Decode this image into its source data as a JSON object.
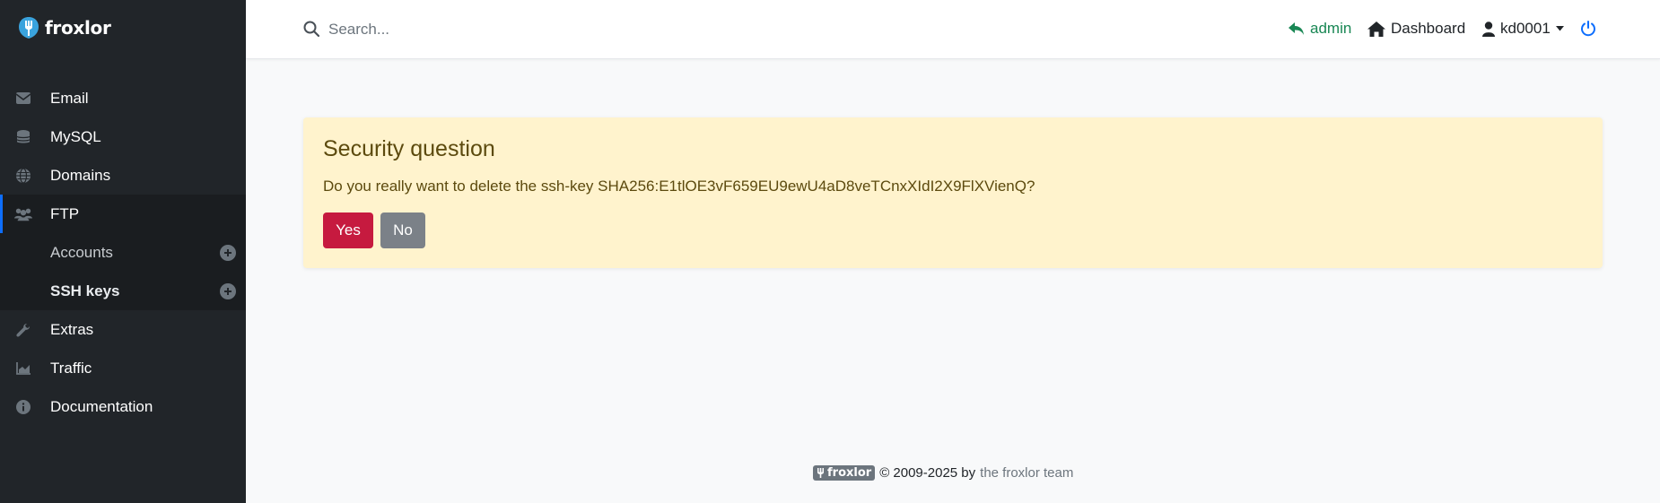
{
  "brand": {
    "name": "froxlor"
  },
  "sidebar": {
    "items": [
      {
        "label": "Email",
        "icon": "envelope-icon"
      },
      {
        "label": "MySQL",
        "icon": "database-icon"
      },
      {
        "label": "Domains",
        "icon": "globe-icon"
      },
      {
        "label": "FTP",
        "icon": "users-icon",
        "active": true
      },
      {
        "label": "Accounts",
        "sub": true,
        "icon": "plus-circle-icon"
      },
      {
        "label": "SSH keys",
        "sub": true,
        "current": true,
        "icon": "plus-circle-icon"
      },
      {
        "label": "Extras",
        "icon": "wrench-icon"
      },
      {
        "label": "Traffic",
        "icon": "chart-area-icon"
      },
      {
        "label": "Documentation",
        "icon": "info-circle-icon"
      }
    ]
  },
  "header": {
    "search_placeholder": "Search...",
    "admin_label": "admin",
    "dashboard_label": "Dashboard",
    "user_label": "kd0001"
  },
  "alert": {
    "title": "Security question",
    "message": "Do you really want to delete the ssh-key SHA256:E1tlOE3vF659EU9ewU4aD8veTCnxXIdI2X9FlXVienQ?",
    "yes_label": "Yes",
    "no_label": "No"
  },
  "footer": {
    "logo_text": "froxlor",
    "copyright": "© 2009-2025 by",
    "team_link": "the froxlor team"
  },
  "colors": {
    "sidebar_bg": "#212529",
    "accent_green": "#198754",
    "alert_bg": "#fff3cd",
    "danger": "#c61a3f",
    "secondary": "#7b8188",
    "power_blue": "#0d6efd"
  }
}
